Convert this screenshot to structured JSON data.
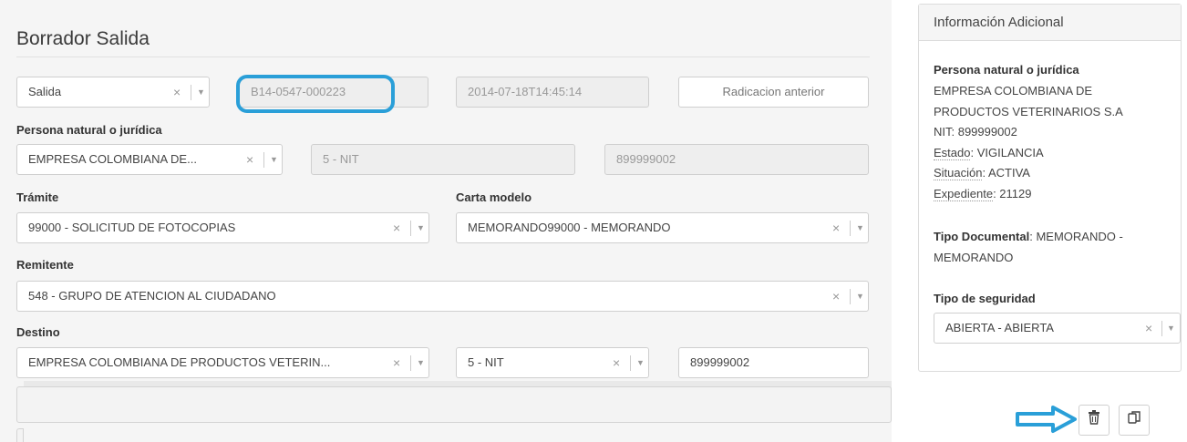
{
  "form": {
    "title": "Borrador Salida",
    "tipo": {
      "value": "Salida",
      "clear": "×",
      "arrow": "▼"
    },
    "radicado": "B14-0547-000223",
    "fecha": "2014-07-18T14:45:14",
    "radicacion_anterior_placeholder": "Radicacion anterior",
    "persona_label": "Persona natural o jurídica",
    "persona": {
      "value": "EMPRESA COLOMBIANA DE...",
      "clear": "×",
      "arrow": "▼"
    },
    "persona_tipo_doc": "5 - NIT",
    "persona_numero": "899999002",
    "tramite_label": "Trámite",
    "tramite": {
      "value": "99000 - SOLICITUD DE FOTOCOPIAS",
      "clear": "×",
      "arrow": "▼"
    },
    "carta_label": "Carta modelo",
    "carta": {
      "value": "MEMORANDO99000 - MEMORANDO",
      "clear": "×",
      "arrow": "▼"
    },
    "remitente_label": "Remitente",
    "remitente": {
      "value": "548 - GRUPO DE ATENCION AL CIUDADANO",
      "clear": "×",
      "arrow": "▼"
    },
    "destino_label": "Destino",
    "destino": {
      "value": "EMPRESA COLOMBIANA DE PRODUCTOS VETERIN...",
      "clear": "×",
      "arrow": "▼"
    },
    "destino_tipo_doc": {
      "value": "5 - NIT",
      "clear": "×",
      "arrow": "▼"
    },
    "destino_numero": "899999002"
  },
  "sidebar": {
    "header": "Información Adicional",
    "persona_heading": "Persona natural o jurídica",
    "empresa_line1": "EMPRESA COLOMBIANA DE",
    "empresa_line2": "PRODUCTOS VETERINARIOS S.A",
    "nit": "NIT: 899999002",
    "estado_label": "Estado",
    "estado_value": ": VIGILANCIA",
    "situacion_label": "Situación",
    "situacion_value": ": ACTIVA",
    "expediente_label": "Expediente",
    "expediente_value": ": 21129",
    "tipo_doc_label": "Tipo Documental",
    "tipo_doc_value": ": MEMORANDO -",
    "tipo_doc_value2": "MEMORANDO",
    "seguridad_label": "Tipo de seguridad",
    "seguridad": {
      "value": "ABIERTA - ABIERTA",
      "clear": "×",
      "arrow": "▼"
    }
  },
  "actions": {
    "delete_icon": "🗑",
    "copy_icon": "⧉"
  },
  "colors": {
    "highlight": "#2a9fd8",
    "arrow": "#2a9fd8"
  }
}
